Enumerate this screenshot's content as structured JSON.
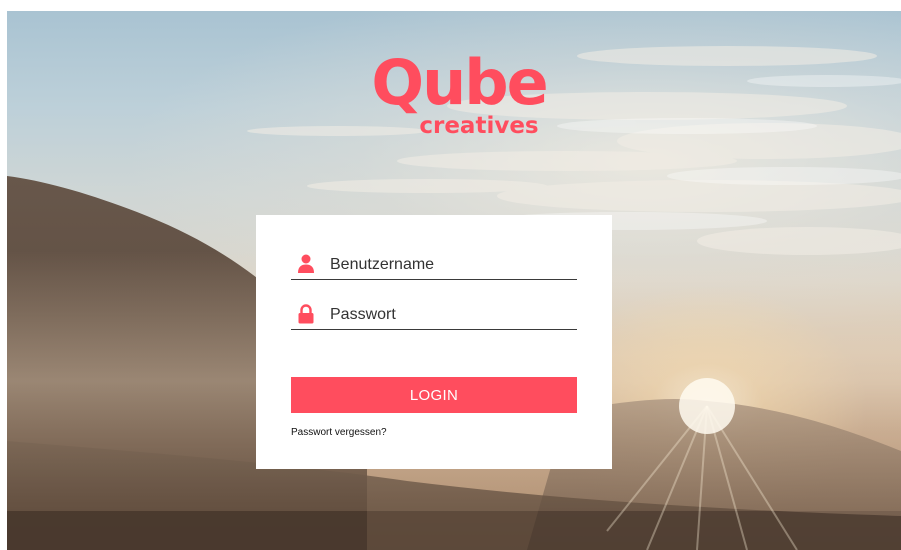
{
  "brand": {
    "name": "Qube",
    "subtitle": "creatives",
    "color": "#ff4d5e"
  },
  "login_form": {
    "username_placeholder": "Benutzername",
    "username_value": "",
    "username_icon": "user-icon",
    "password_placeholder": "Passwort",
    "password_value": "",
    "password_icon": "lock-icon",
    "login_button_label": "LOGIN",
    "forgot_password_label": "Passwort vergessen?"
  },
  "background": {
    "description_icon": "landscape-photo"
  }
}
